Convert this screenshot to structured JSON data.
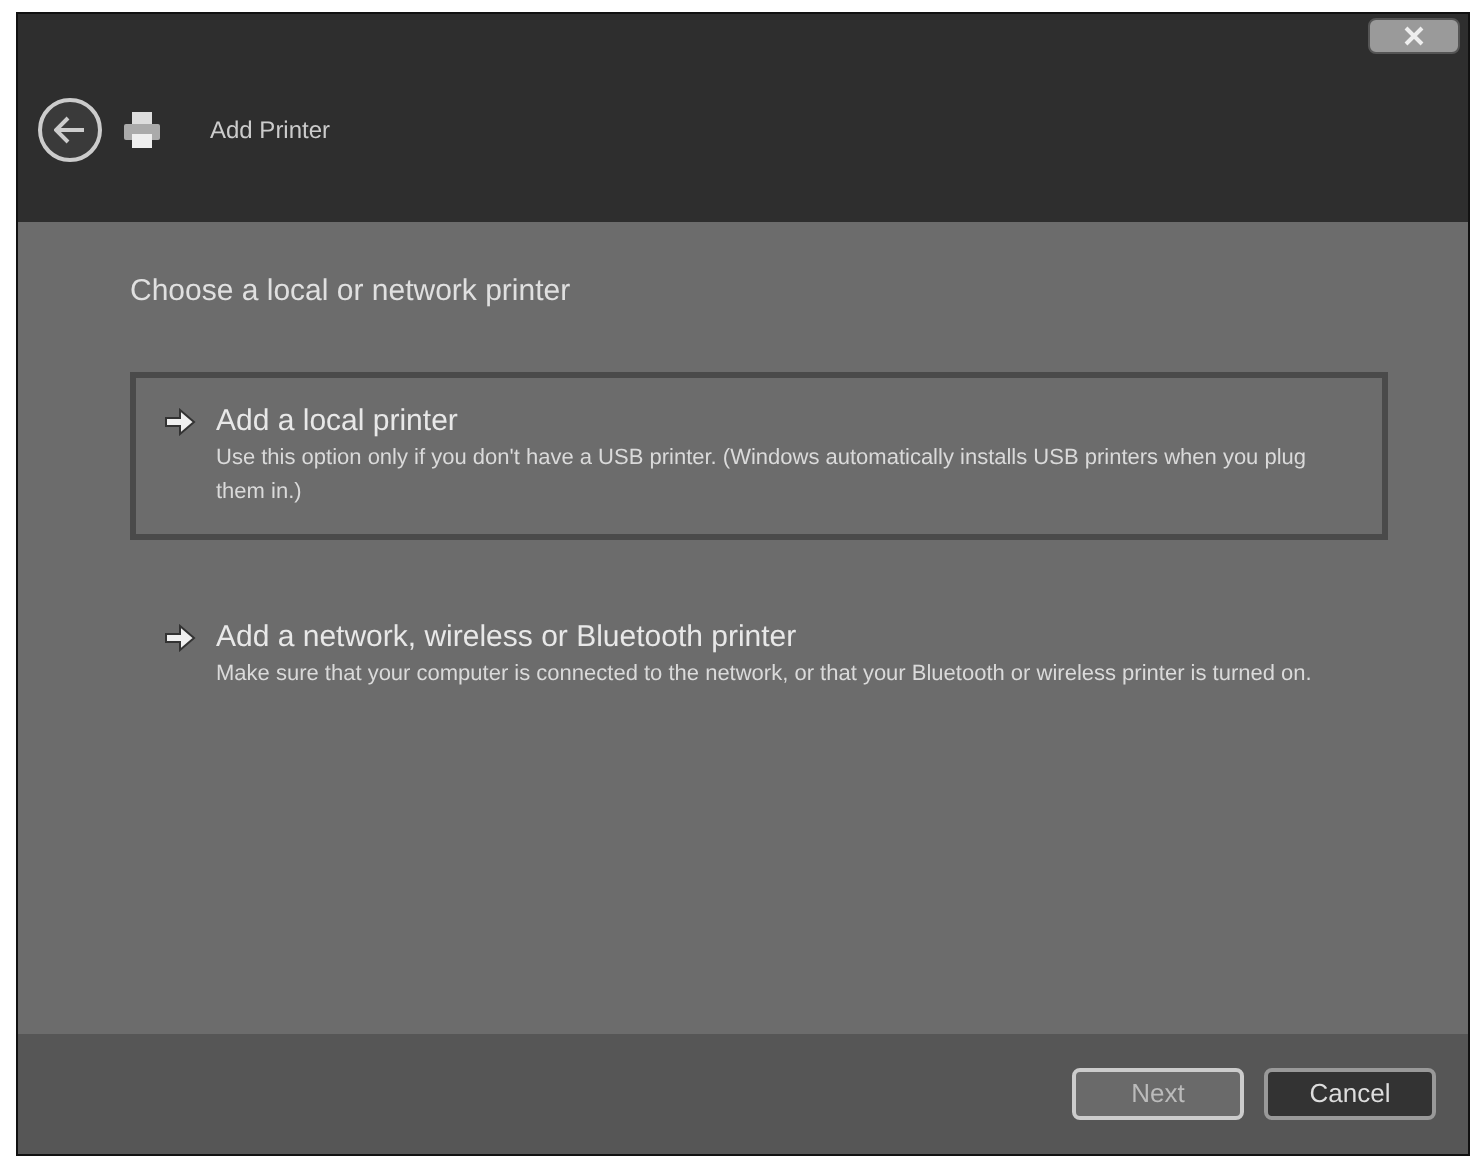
{
  "window": {
    "title": "Add Printer"
  },
  "heading": "Choose a local or network printer",
  "options": [
    {
      "title": "Add a local printer",
      "description": "Use this option only if you don't have a USB printer. (Windows automatically installs USB printers when you plug them in.)",
      "selected": true
    },
    {
      "title": "Add a network, wireless or Bluetooth printer",
      "description": "Make sure that your computer is connected to the network, or that your Bluetooth or wireless printer is turned on.",
      "selected": false
    }
  ],
  "buttons": [
    {
      "label": "Next",
      "disabled": true
    },
    {
      "label": "Cancel",
      "disabled": false
    }
  ]
}
